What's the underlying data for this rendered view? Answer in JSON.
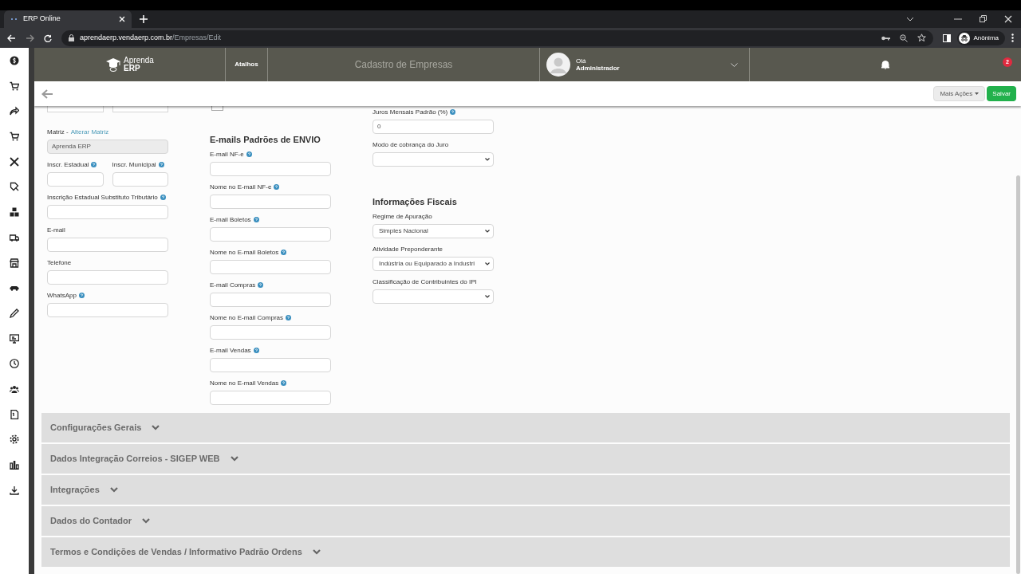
{
  "browser": {
    "tab_title": "ERP Online",
    "url_host": "aprendaerp.vendaerp.com.br",
    "url_path": "/Empresas/Edit",
    "profile": "Anônima"
  },
  "header": {
    "logo_top": "Aprenda",
    "logo_bottom": "ERP",
    "shortcuts": "Atalhos",
    "page_title": "Cadastro de Empresas",
    "greeting": "Olá",
    "user": "Administrador",
    "notifications": "2"
  },
  "toolbar": {
    "more_actions": "Mais Ações",
    "save": "Salvar"
  },
  "columns": [
    [
      {
        "kind": "readonly",
        "label": "Matriz -",
        "link": "Alterar Matriz",
        "value": "Aprenda ERP"
      },
      {
        "kind": "pair",
        "items": [
          {
            "label": "Inscr. Estadual",
            "help": true
          },
          {
            "label": "Inscr. Municipal",
            "help": true
          }
        ]
      },
      {
        "kind": "input",
        "label": "Inscrição Estadual Substituto Tributário",
        "help": true
      },
      {
        "kind": "input",
        "label": "E-mail",
        "help": false
      },
      {
        "kind": "input",
        "label": "Telefone",
        "help": false
      },
      {
        "kind": "input",
        "label": "WhatsApp",
        "help": true
      }
    ],
    [
      {
        "kind": "checkbox",
        "checked": false
      },
      {
        "kind": "heading",
        "label": "E-mails Padrões de ENVIO"
      },
      {
        "kind": "input",
        "label": "E-mail NF-e",
        "help": true
      },
      {
        "kind": "input",
        "label": "Nome no E-mail NF-e",
        "help": true
      },
      {
        "kind": "input",
        "label": "E-mail Boletos",
        "help": true
      },
      {
        "kind": "input",
        "label": "Nome no E-mail Boletos",
        "help": true
      },
      {
        "kind": "input",
        "label": "E-mail Compras",
        "help": true
      },
      {
        "kind": "input",
        "label": "Nome no E-mail Compras",
        "help": true
      },
      {
        "kind": "input",
        "label": "E-mail Vendas",
        "help": true
      },
      {
        "kind": "input",
        "label": "Nome no E-mail Vendas",
        "help": true
      }
    ],
    [
      {
        "kind": "input",
        "label": "Juros Mensais Padrão (%)",
        "help": true,
        "value": "0"
      },
      {
        "kind": "select",
        "label": "Modo de cobrança do Juro"
      },
      {
        "kind": "heading",
        "label": "Informações Fiscais"
      },
      {
        "kind": "select",
        "label": "Regime de Apuração",
        "value": "Simples Nacional"
      },
      {
        "kind": "select",
        "label": "Atividade Preponderante",
        "value": "Indústria ou Equiparado a Industri"
      },
      {
        "kind": "select",
        "label": "Classificação de Contribuintes do IPI"
      }
    ]
  ],
  "sections": [
    {
      "title": "Configurações Gerais",
      "expanded": false
    },
    {
      "title": "Dados Integração Correios - SIGEP WEB",
      "expanded": false
    },
    {
      "title": "Integrações",
      "expanded": false
    },
    {
      "title": "Dados do Contador",
      "expanded": false
    },
    {
      "title": "Termos e Condições de Vendas / Informativo Padrão Ordens",
      "expanded": false
    }
  ]
}
